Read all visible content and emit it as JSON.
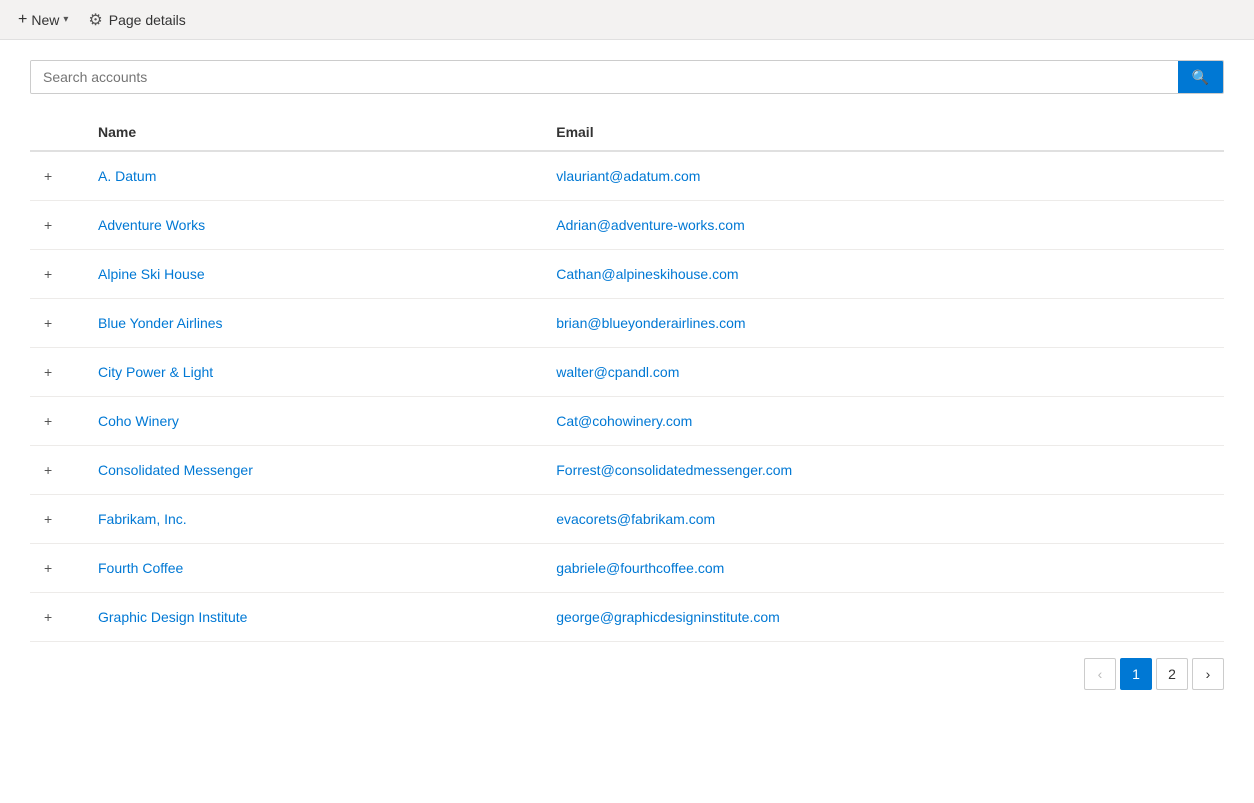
{
  "toolbar": {
    "new_label": "New",
    "page_details_label": "Page details"
  },
  "search": {
    "placeholder": "Search accounts",
    "value": ""
  },
  "table": {
    "columns": [
      {
        "key": "expand",
        "label": ""
      },
      {
        "key": "name",
        "label": "Name"
      },
      {
        "key": "email",
        "label": "Email"
      }
    ],
    "rows": [
      {
        "name": "A. Datum",
        "email": "vlauriant@adatum.com"
      },
      {
        "name": "Adventure Works",
        "email": "Adrian@adventure-works.com"
      },
      {
        "name": "Alpine Ski House",
        "email": "Cathan@alpineskihouse.com"
      },
      {
        "name": "Blue Yonder Airlines",
        "email": "brian@blueyonderairlines.com"
      },
      {
        "name": "City Power & Light",
        "email": "walter@cpandl.com"
      },
      {
        "name": "Coho Winery",
        "email": "Cat@cohowinery.com"
      },
      {
        "name": "Consolidated Messenger",
        "email": "Forrest@consolidatedmessenger.com"
      },
      {
        "name": "Fabrikam, Inc.",
        "email": "evacorets@fabrikam.com"
      },
      {
        "name": "Fourth Coffee",
        "email": "gabriele@fourthcoffee.com"
      },
      {
        "name": "Graphic Design Institute",
        "email": "george@graphicdesigninstitute.com"
      }
    ]
  },
  "pagination": {
    "current_page": 1,
    "total_pages": 2,
    "prev_label": "‹",
    "next_label": "›"
  }
}
